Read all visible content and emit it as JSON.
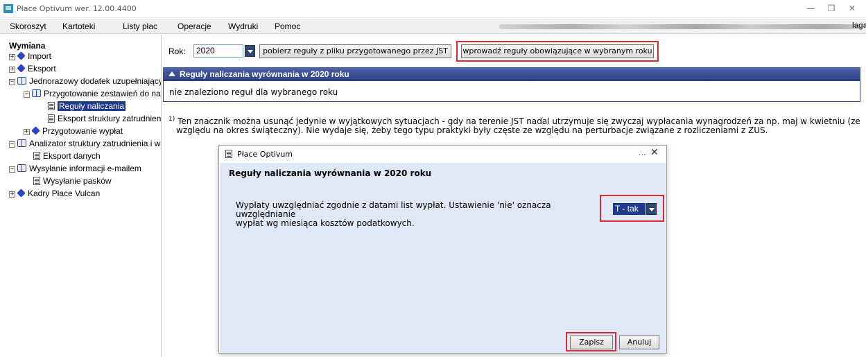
{
  "window": {
    "title": "Płace Optivum wer. 12.00.4400",
    "minimize": "—",
    "restore": "❐",
    "close": "✕"
  },
  "menu": {
    "items": [
      "Skoroszyt",
      "Kartoteki",
      "Listy płac",
      "Operacje",
      "Wydruki",
      "Pomoc"
    ],
    "right_text_end": "laga"
  },
  "tree": {
    "root": "Wymiana",
    "nodes": [
      {
        "label": "Import",
        "expander": "+",
        "icon": "gem-icon"
      },
      {
        "label": "Eksport",
        "expander": "+",
        "icon": "gem-icon"
      },
      {
        "label": "Jednorazowy dodatek uzupełniający",
        "expander": "−",
        "icon": "book-icon"
      },
      {
        "label": "Przygotowanie zestawień do nal",
        "expander": "−",
        "icon": "book-icon"
      },
      {
        "label": "Reguły naliczania",
        "icon": "document-icon",
        "selected": true
      },
      {
        "label": "Eksport struktury zatrudnieni",
        "icon": "document-icon"
      },
      {
        "label": "Przygotowanie wypłat",
        "expander": "+",
        "icon": "gem-icon"
      },
      {
        "label": "Analizator struktury zatrudnienia i w",
        "expander": "−",
        "icon": "book-icon"
      },
      {
        "label": "Eksport danych",
        "icon": "document-icon"
      },
      {
        "label": "Wysyłanie informacji e-mailem",
        "expander": "−",
        "icon": "book-icon"
      },
      {
        "label": "Wysyłanie pasków",
        "icon": "document-icon"
      },
      {
        "label": "Kadry Płace Vulcan",
        "expander": "+",
        "icon": "gem-icon"
      }
    ]
  },
  "toolbar": {
    "rok_label": "Rok:",
    "year_value": "2020",
    "fetch_rules_button": "pobierz reguły z pliku przygotowanego przez JST",
    "apply_rules_button": "wprowadź reguły obowiązujące w wybranym roku"
  },
  "section": {
    "header": "Reguły naliczania wyrównania w 2020 roku",
    "body": "nie znaleziono reguł dla wybranego roku"
  },
  "footnote": {
    "marker": "1)",
    "line1": "Ten znacznik można usunąć jedynie w wyjątkowych sytuacjach - gdy na terenie JST  nadal utrzymuje się zwyczaj wypłacania wynagrodzeń za np. maj w kwietniu (ze",
    "line2": "względu na okres świąteczny). Nie wydaje się, żeby tego typu praktyki były częste ze względu na perturbacje związane z rozliczeniami z ZUS."
  },
  "dialog": {
    "title": "Płace Optivum",
    "dots": "...",
    "close": "✕",
    "heading": "Reguły naliczania wyrównania w 2020 roku",
    "description_line1": "Wypłaty uwzględniać zgodnie z datami list wypłat. Ustawienie 'nie' oznacza uwzględnianie",
    "description_line2": "wypłat wg miesiąca kosztów podatkowych.",
    "select_value": "T - tak",
    "save_button": "Zapisz",
    "cancel_button": "Anuluj"
  },
  "colors": {
    "highlight_frame": "#e0262f",
    "header_blue": "#2c3f84",
    "selection_blue": "#1e3a8a",
    "dialog_bg": "#dfe8f7"
  }
}
